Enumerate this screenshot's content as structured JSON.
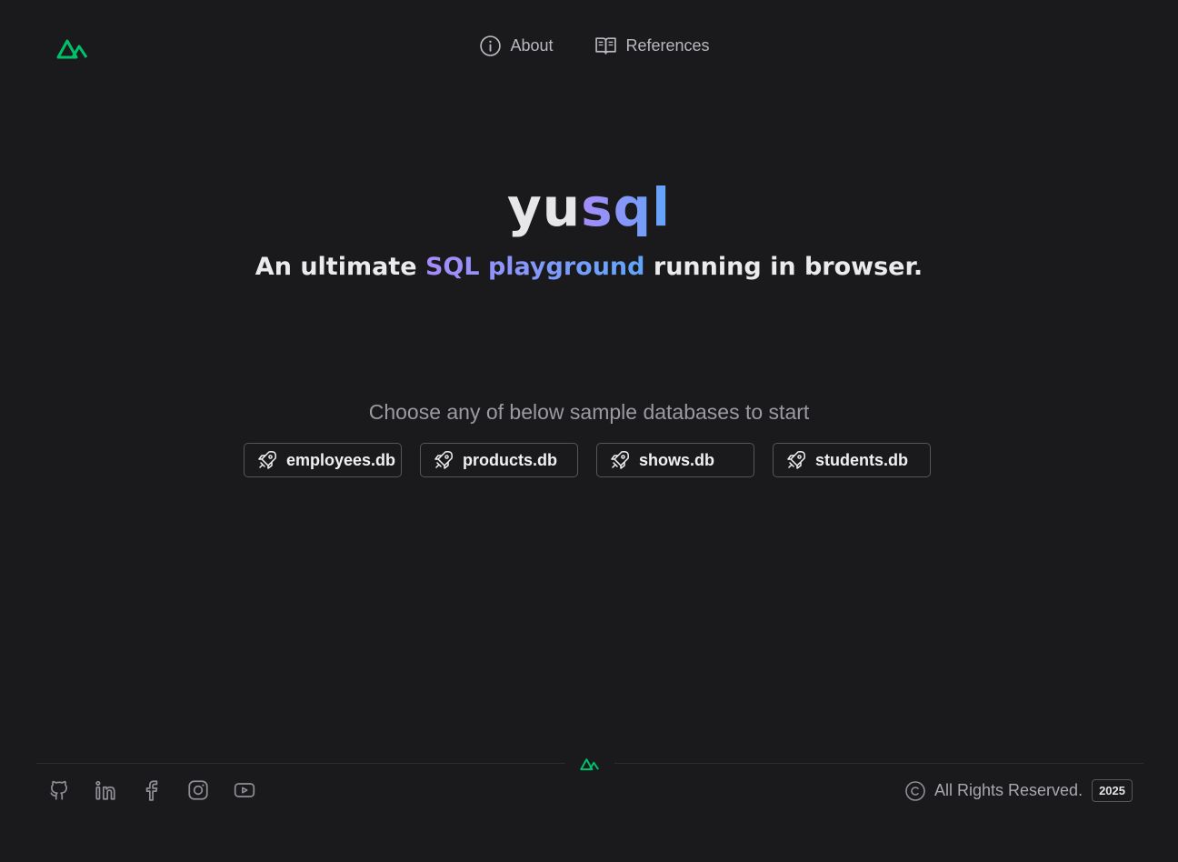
{
  "nav": {
    "about": "About",
    "references": "References"
  },
  "hero": {
    "brand_plain": "yu",
    "brand_accent": "sql",
    "tagline_before": "An ultimate ",
    "tagline_accent": "SQL playground",
    "tagline_after": " running in browser."
  },
  "databases": {
    "prompt": "Choose any of below sample databases to start",
    "items": [
      "employees.db",
      "products.db",
      "shows.db",
      "students.db"
    ]
  },
  "footer": {
    "copyright": "All Rights Reserved.",
    "year": "2025",
    "social_icons": [
      "github-icon",
      "linkedin-icon",
      "facebook-icon",
      "instagram-icon",
      "youtube-icon"
    ]
  },
  "colors": {
    "background": "#1a1a1d",
    "brand_green": "#00c16a",
    "gradient_start": "#a78bfa",
    "gradient_end": "#60a5fa"
  }
}
